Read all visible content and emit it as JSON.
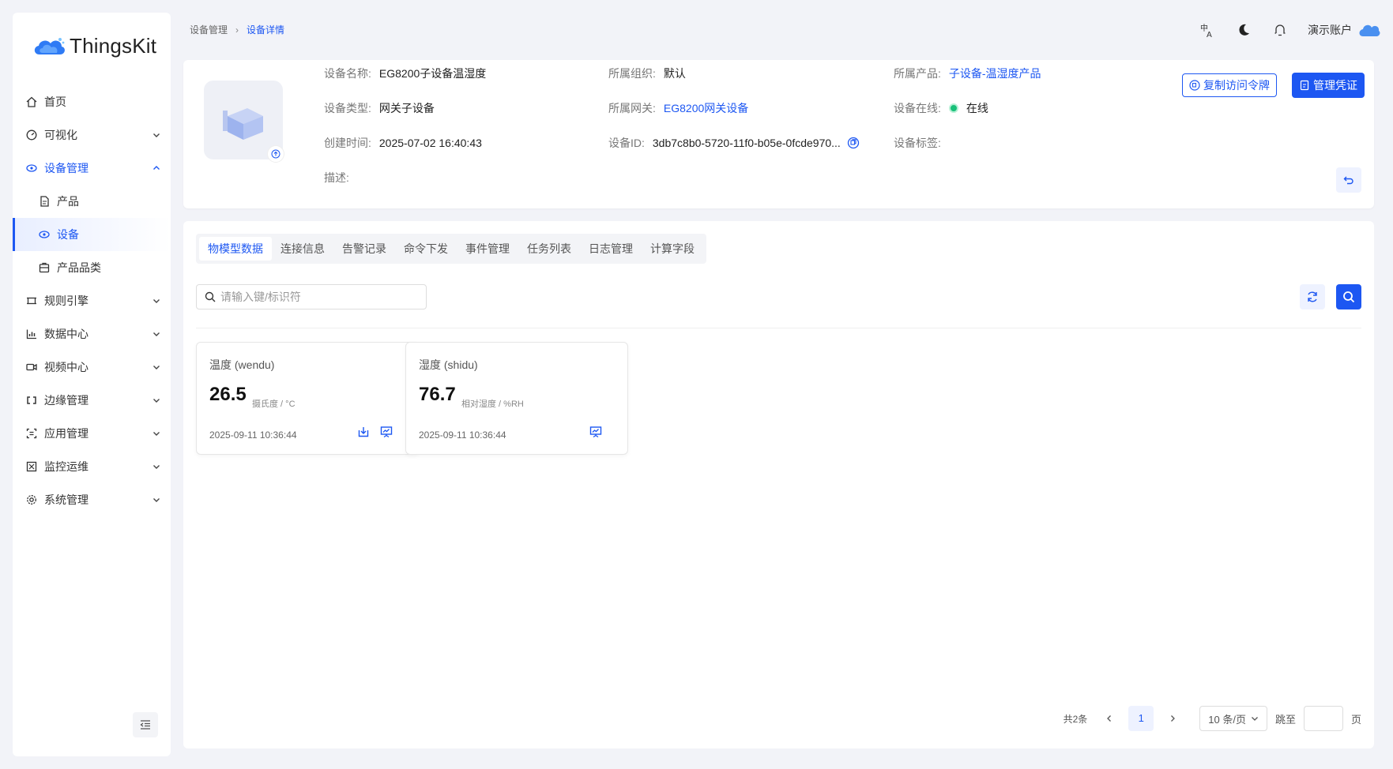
{
  "app": {
    "name": "ThingsKit"
  },
  "sidebar": {
    "items": [
      {
        "label": "首页",
        "icon": "home-icon",
        "has_children": false
      },
      {
        "label": "可视化",
        "icon": "dashboard-icon",
        "has_children": true
      },
      {
        "label": "设备管理",
        "icon": "device-icon",
        "has_children": true,
        "expanded": true
      },
      {
        "label": "产品",
        "icon": "product-doc-icon",
        "sub": true
      },
      {
        "label": "设备",
        "icon": "device-icon",
        "sub": true,
        "selected": true
      },
      {
        "label": "产品品类",
        "icon": "category-icon",
        "sub": true
      },
      {
        "label": "规则引擎",
        "icon": "rule-engine-icon",
        "has_children": true
      },
      {
        "label": "数据中心",
        "icon": "chart-icon",
        "has_children": true
      },
      {
        "label": "视频中心",
        "icon": "video-icon",
        "has_children": true
      },
      {
        "label": "边缘管理",
        "icon": "edge-icon",
        "has_children": true
      },
      {
        "label": "应用管理",
        "icon": "app-icon",
        "has_children": true
      },
      {
        "label": "监控运维",
        "icon": "monitor-icon",
        "has_children": true
      },
      {
        "label": "系统管理",
        "icon": "settings-icon",
        "has_children": true
      }
    ]
  },
  "breadcrumb": {
    "parent": "设备管理",
    "current": "设备详情"
  },
  "header": {
    "account": "演示账户"
  },
  "device": {
    "name_label": "设备名称:",
    "name": "EG8200子设备温湿度",
    "org_label": "所属组织:",
    "org": "默认",
    "product_label": "所属产品:",
    "product": "子设备-温湿度产品",
    "type_label": "设备类型:",
    "type": "网关子设备",
    "gateway_label": "所属网关:",
    "gateway": "EG8200网关设备",
    "online_label": "设备在线:",
    "online": "在线",
    "created_label": "创建时间:",
    "created": "2025-07-02 16:40:43",
    "id_label": "设备ID:",
    "id": "3db7c8b0-5720-11f0-b05e-0fcde970...",
    "tags_label": "设备标签:",
    "desc_label": "描述:"
  },
  "actions": {
    "copy_token": "复制访问令牌",
    "manage_credentials": "管理凭证"
  },
  "tabs": [
    "物模型数据",
    "连接信息",
    "告警记录",
    "命令下发",
    "事件管理",
    "任务列表",
    "日志管理",
    "计算字段"
  ],
  "search": {
    "placeholder": "请输入键/标识符"
  },
  "data_cards": [
    {
      "title": "温度 (wendu)",
      "value": "26.5",
      "unit": "摄氏度 / °C",
      "time": "2025-09-11 10:36:44"
    },
    {
      "title": "湿度 (shidu)",
      "value": "76.7",
      "unit": "相对湿度 / %RH",
      "time": "2025-09-11 10:36:44"
    }
  ],
  "pagination": {
    "total": "共2条",
    "page": "1",
    "page_size": "10 条/页",
    "jump_label": "跳至",
    "page_suffix": "页"
  },
  "colors": {
    "primary": "#1d57f2",
    "online": "#18c079",
    "background": "#f2f3f8"
  }
}
